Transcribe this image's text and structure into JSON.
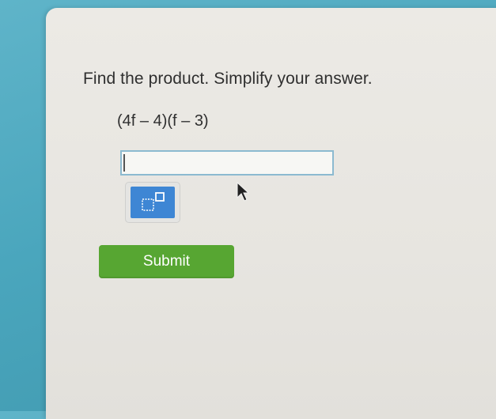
{
  "question": {
    "prompt": "Find the product. Simplify your answer.",
    "expression": "(4f – 4)(f – 3)"
  },
  "answer": {
    "value": "",
    "placeholder": ""
  },
  "tools": {
    "exponent_icon": "superscript-box-icon"
  },
  "actions": {
    "submit_label": "Submit"
  },
  "colors": {
    "background": "#4aa6bd",
    "panel": "#e8e6e1",
    "submit": "#57a632",
    "tool_button": "#3e86d4",
    "input_border": "#8cbad0"
  }
}
